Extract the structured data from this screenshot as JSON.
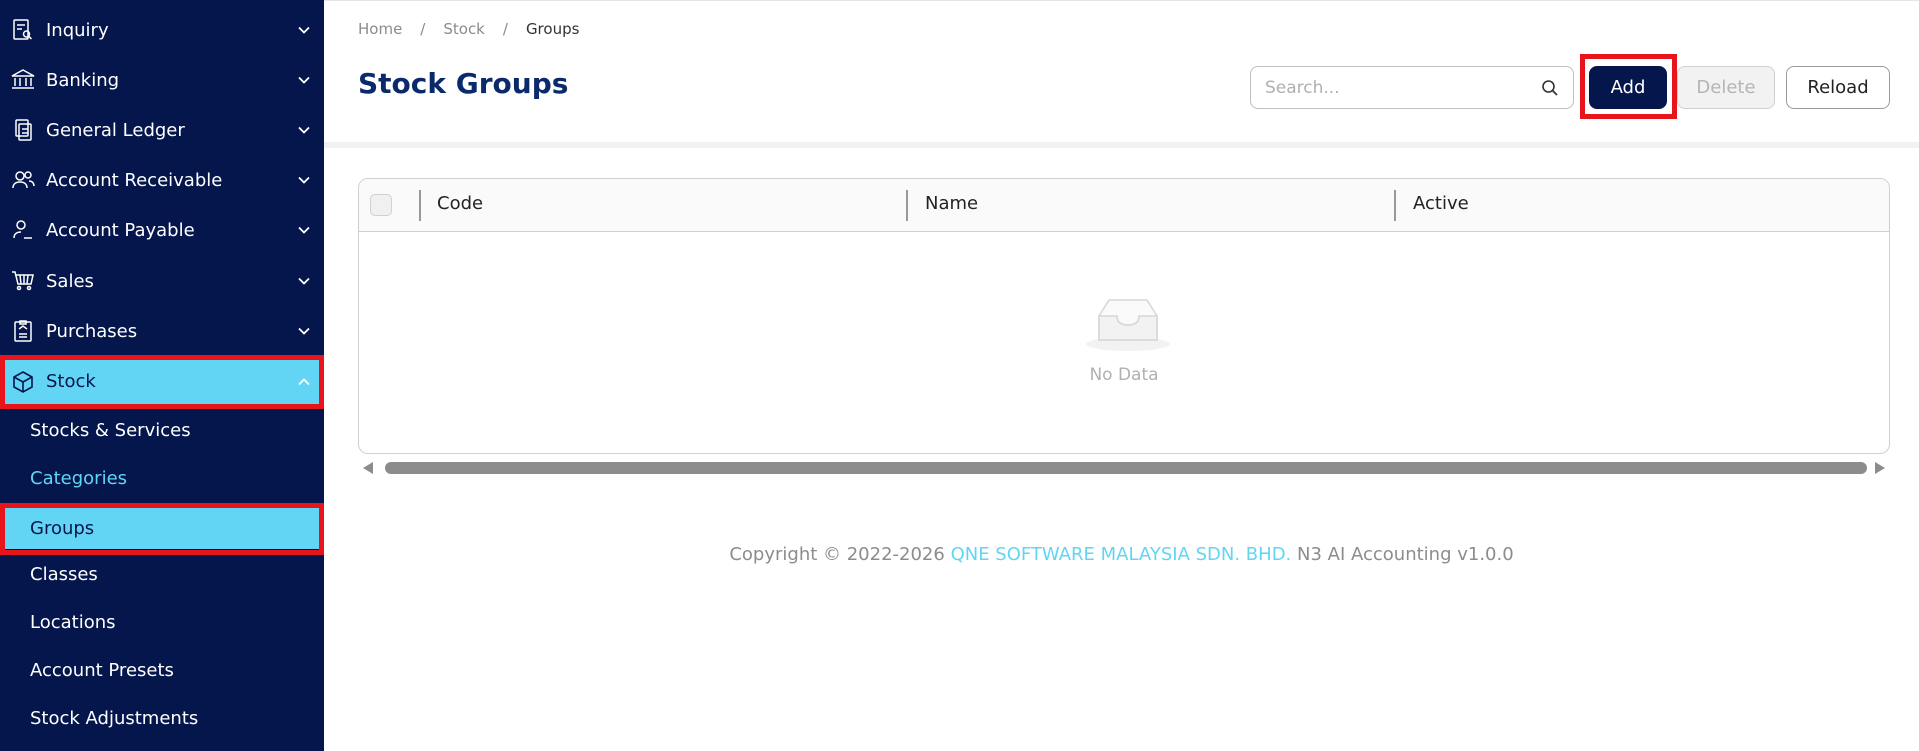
{
  "sidebar": {
    "items": [
      {
        "label": "Inquiry",
        "icon": "inquiry-icon"
      },
      {
        "label": "Banking",
        "icon": "bank-icon"
      },
      {
        "label": "General Ledger",
        "icon": "ledger-icon"
      },
      {
        "label": "Account Receivable",
        "icon": "users-icon"
      },
      {
        "label": "Account Payable",
        "icon": "user-edit-icon"
      },
      {
        "label": "Sales",
        "icon": "cart-icon"
      },
      {
        "label": "Purchases",
        "icon": "clipboard-icon"
      },
      {
        "label": "Stock",
        "icon": "box-icon"
      }
    ],
    "stock_sub": [
      {
        "label": "Stocks & Services"
      },
      {
        "label": "Categories"
      },
      {
        "label": "Groups"
      },
      {
        "label": "Classes"
      },
      {
        "label": "Locations"
      },
      {
        "label": "Account Presets"
      },
      {
        "label": "Stock Adjustments"
      }
    ]
  },
  "breadcrumb": {
    "home": "Home",
    "stock": "Stock",
    "current": "Groups",
    "sep": "/"
  },
  "page": {
    "title": "Stock Groups"
  },
  "toolbar": {
    "search_placeholder": "Search...",
    "add_label": "Add",
    "delete_label": "Delete",
    "reload_label": "Reload"
  },
  "table": {
    "columns": [
      "Code",
      "Name",
      "Active"
    ],
    "rows": [],
    "empty_text": "No Data"
  },
  "footer": {
    "prefix": "Copyright © 2022-2026 ",
    "company": "QNE SOFTWARE MALAYSIA SDN. BHD.",
    "suffix": " N3 AI Accounting v1.0.0"
  },
  "colors": {
    "sidebar_bg": "#05164d",
    "accent": "#62d5f4",
    "highlight": "#e8141b",
    "title": "#0b2a6b"
  }
}
